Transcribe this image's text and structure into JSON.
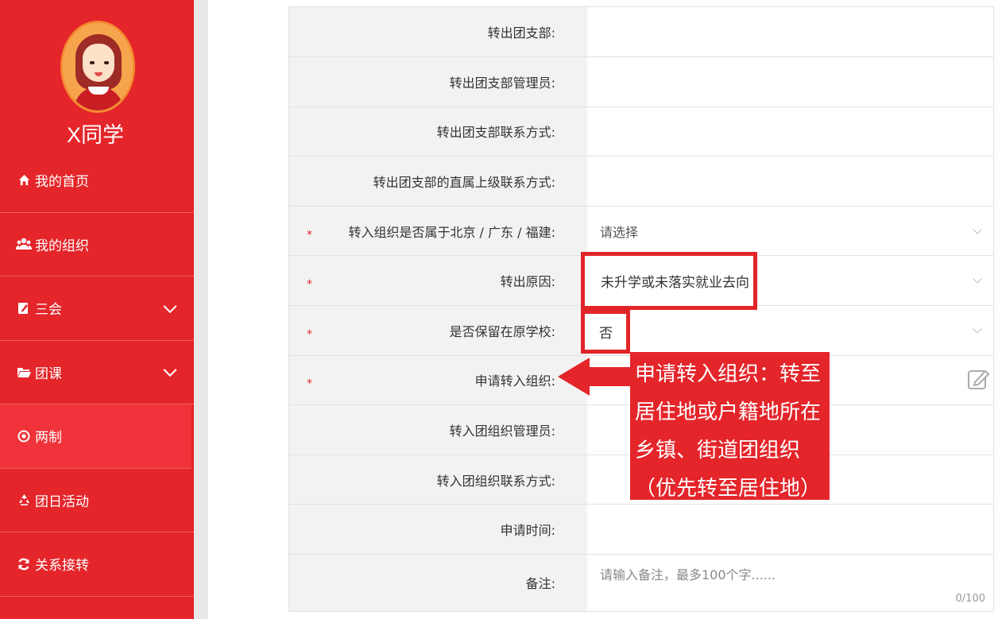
{
  "user": {
    "name": "X同学"
  },
  "nav": {
    "items": [
      {
        "label": "我的首页",
        "icon": "home-icon"
      },
      {
        "label": "我的组织",
        "icon": "users-icon"
      },
      {
        "label": "三会",
        "icon": "edit-icon"
      },
      {
        "label": "团课",
        "icon": "folder-icon"
      },
      {
        "label": "两制",
        "icon": "target-icon"
      },
      {
        "label": "团日活动",
        "icon": "recycle-icon"
      },
      {
        "label": "关系接转",
        "icon": "refresh-icon"
      }
    ]
  },
  "form": {
    "fields": [
      {
        "label": "转出团支部:",
        "value": ""
      },
      {
        "label": "转出团支部管理员:",
        "value": ""
      },
      {
        "label": "转出团支部联系方式:",
        "value": ""
      },
      {
        "label": "转出团支部的直属上级联系方式:",
        "value": ""
      },
      {
        "label": "转入组织是否属于北京 / 广东 / 福建:",
        "value": "",
        "placeholder": "请选择"
      },
      {
        "label": "转出原因:",
        "value": "未升学或未落实就业去向"
      },
      {
        "label": "是否保留在原学校:",
        "value": "否"
      },
      {
        "label": "申请转入组织:",
        "value": ""
      },
      {
        "label": "转入团组织管理员:",
        "value": ""
      },
      {
        "label": "转入团组织联系方式:",
        "value": ""
      },
      {
        "label": "申请时间:",
        "value": ""
      },
      {
        "label": "备注:",
        "value": "",
        "placeholder": "请输入备注，最多100个字......",
        "counter": "0/100"
      }
    ],
    "required_mark": "*"
  },
  "callout": {
    "text": "申请转入组织：转至居住地或户籍地所在乡镇、街道团组织（优先转至居住地）"
  },
  "colors": {
    "brand_red": "#e4252a",
    "active_nav": "#f0333a"
  }
}
